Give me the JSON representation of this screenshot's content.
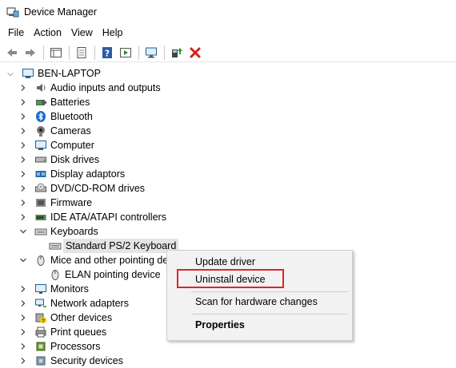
{
  "window": {
    "title": "Device Manager"
  },
  "menu": {
    "file": "File",
    "action": "Action",
    "view": "View",
    "help": "Help"
  },
  "toolbar": {
    "icons": [
      "back-arrow-icon",
      "forward-arrow-icon",
      "show-hide-tree-icon",
      "properties-sheet-icon",
      "help-icon",
      "run-action-icon",
      "monitor-scan-icon",
      "update-driver-icon",
      "uninstall-x-icon"
    ]
  },
  "tree": {
    "root": "BEN-LAPTOP",
    "items": [
      {
        "label": "Audio inputs and outputs",
        "icon": "speaker-icon"
      },
      {
        "label": "Batteries",
        "icon": "battery-icon"
      },
      {
        "label": "Bluetooth",
        "icon": "bluetooth-icon"
      },
      {
        "label": "Cameras",
        "icon": "camera-icon"
      },
      {
        "label": "Computer",
        "icon": "computer-icon"
      },
      {
        "label": "Disk drives",
        "icon": "disk-drive-icon"
      },
      {
        "label": "Display adaptors",
        "icon": "display-adapter-icon"
      },
      {
        "label": "DVD/CD-ROM drives",
        "icon": "dvd-icon"
      },
      {
        "label": "Firmware",
        "icon": "firmware-icon"
      },
      {
        "label": "IDE ATA/ATAPI controllers",
        "icon": "ide-controller-icon"
      },
      {
        "label": "Keyboards",
        "icon": "keyboard-icon",
        "expanded": true
      },
      {
        "label": "Standard PS/2 Keyboard",
        "icon": "keyboard-icon",
        "child": true,
        "selected": true
      },
      {
        "label": "Mice and other pointing de",
        "icon": "mouse-icon",
        "expanded": true
      },
      {
        "label": "ELAN pointing device",
        "icon": "mouse-icon",
        "child": true
      },
      {
        "label": "Monitors",
        "icon": "monitor-icon"
      },
      {
        "label": "Network adapters",
        "icon": "network-icon"
      },
      {
        "label": "Other devices",
        "icon": "other-devices-icon"
      },
      {
        "label": "Print queues",
        "icon": "printer-icon"
      },
      {
        "label": "Processors",
        "icon": "processor-icon"
      },
      {
        "label": "Security devices",
        "icon": "security-icon"
      }
    ]
  },
  "context_menu": {
    "update_driver": "Update driver",
    "uninstall_device": "Uninstall device",
    "scan_hardware": "Scan for hardware changes",
    "properties": "Properties"
  },
  "colors": {
    "highlight": "#d9262c",
    "selection": "#e5e5e5",
    "menu_bg": "#f2f2f2"
  }
}
